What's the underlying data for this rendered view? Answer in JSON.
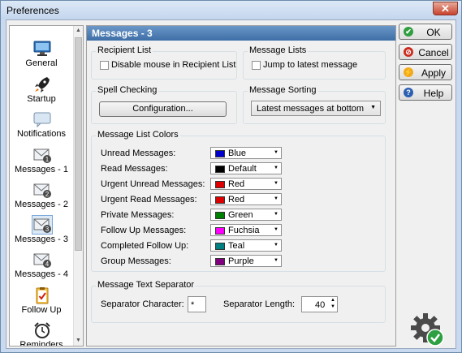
{
  "window": {
    "title": "Preferences",
    "close_glyph": "✕"
  },
  "sidebar": {
    "items": [
      {
        "label": "General",
        "icon": "monitor-icon"
      },
      {
        "label": "Startup",
        "icon": "rocket-icon"
      },
      {
        "label": "Notifications",
        "icon": "speech-bubble-icon"
      },
      {
        "label": "Messages - 1",
        "icon": "envelope-1-icon",
        "badge": "1"
      },
      {
        "label": "Messages - 2",
        "icon": "envelope-2-icon",
        "badge": "2"
      },
      {
        "label": "Messages - 3",
        "icon": "envelope-3-icon",
        "badge": "3",
        "selected": true
      },
      {
        "label": "Messages - 4",
        "icon": "envelope-4-icon",
        "badge": "4"
      },
      {
        "label": "Follow Up",
        "icon": "clipboard-check-icon"
      },
      {
        "label": "Reminders",
        "icon": "alarm-clock-icon"
      }
    ]
  },
  "panel": {
    "title": "Messages - 3",
    "recipient_list": {
      "legend": "Recipient List",
      "checkbox_label": "Disable mouse in Recipient List",
      "checked": false
    },
    "message_lists": {
      "legend": "Message Lists",
      "checkbox_label": "Jump to latest message",
      "checked": false
    },
    "spell_checking": {
      "legend": "Spell Checking",
      "button_label": "Configuration..."
    },
    "message_sorting": {
      "legend": "Message Sorting",
      "selected": "Latest messages at bottom"
    },
    "colors": {
      "legend": "Message List Colors",
      "rows": [
        {
          "label": "Unread Messages:",
          "value": "Blue",
          "color": "#0000cc"
        },
        {
          "label": "Read Messages:",
          "value": "Default",
          "color": "#000000"
        },
        {
          "label": "Urgent Unread Messages:",
          "value": "Red",
          "color": "#dd0000"
        },
        {
          "label": "Urgent Read Messages:",
          "value": "Red",
          "color": "#dd0000"
        },
        {
          "label": "Private Messages:",
          "value": "Green",
          "color": "#008000"
        },
        {
          "label": "Follow Up Messages:",
          "value": "Fuchsia",
          "color": "#ff00ff"
        },
        {
          "label": "Completed Follow Up:",
          "value": "Teal",
          "color": "#008080"
        },
        {
          "label": "Group Messages:",
          "value": "Purple",
          "color": "#800080"
        }
      ]
    },
    "separator": {
      "legend": "Message Text Separator",
      "char_label": "Separator Character:",
      "char_value": "*",
      "length_label": "Separator Length:",
      "length_value": "40"
    }
  },
  "buttons": {
    "ok": {
      "label": "OK",
      "color": "#2e9e3e",
      "glyph": "✔"
    },
    "cancel": {
      "label": "Cancel",
      "color": "#cc2b1f",
      "glyph": "⊘"
    },
    "apply": {
      "label": "Apply",
      "color": "#f2a81d",
      "glyph": "⚡"
    },
    "help": {
      "label": "Help",
      "color": "#2b5fb0",
      "glyph": "?"
    }
  }
}
